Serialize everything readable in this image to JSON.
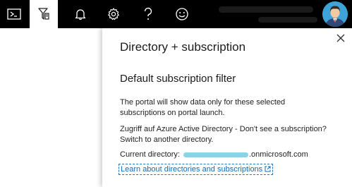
{
  "topbar": {
    "icons": [
      "terminal-icon",
      "filter-icon",
      "bell-icon",
      "gear-icon",
      "help-icon",
      "smiley-icon",
      "avatar"
    ]
  },
  "panel": {
    "title": "Directory + subscription",
    "section_title": "Default subscription filter",
    "paragraph1": "The portal will show data only for these selected subscriptions on portal launch.",
    "paragraph2": "Zugriff auf Azure Active Directory - Don't see a subscription? Switch to another directory.",
    "current_directory_label": "Current directory:",
    "current_directory_suffix": ".onmicrosoft.com",
    "link_text": "Learn about directories and subscriptions"
  }
}
